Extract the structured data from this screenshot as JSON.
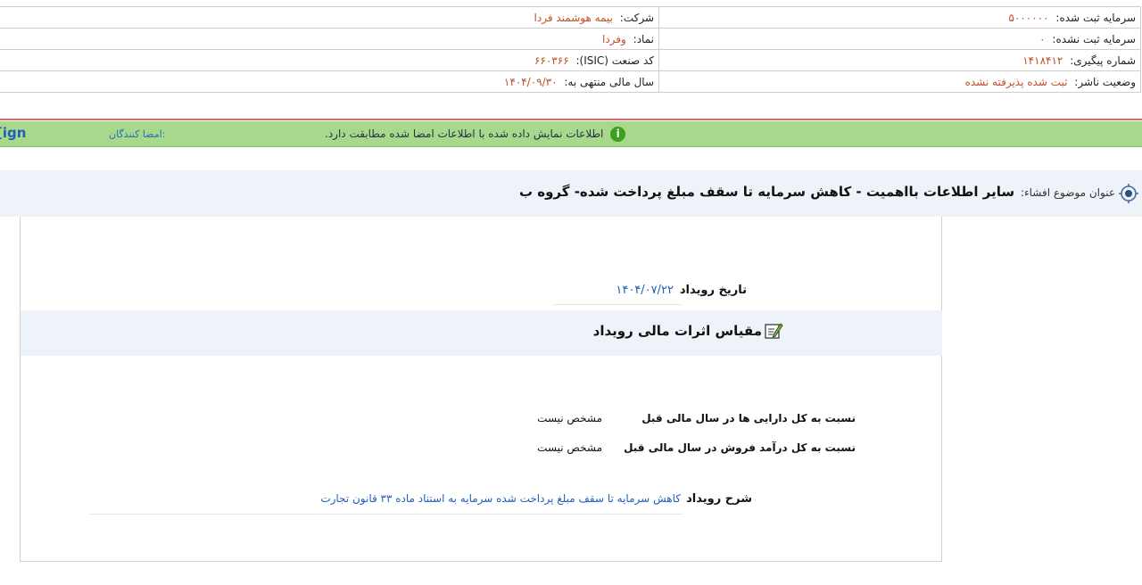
{
  "info": {
    "company_label": "شرکت:",
    "company_value": "بیمه هوشمند فردا",
    "registered_capital_label": "سرمایه ثبت شده:",
    "registered_capital_value": "۵۰۰۰۰۰۰",
    "symbol_label": "نماد:",
    "symbol_value": "وفردا",
    "unregistered_capital_label": "سرمایه ثبت نشده:",
    "unregistered_capital_value": "۰",
    "isic_label": "کد صنعت (ISIC):",
    "isic_value": "۶۶۰۳۶۶",
    "tracking_label": "شماره پیگیری:",
    "tracking_value": "۱۴۱۸۴۱۲",
    "fiscal_year_label": "سال مالی منتهی به:",
    "fiscal_year_value": "۱۴۰۴/۰۹/۳۰",
    "publisher_status_label": "وضعیت ناشر:",
    "publisher_status_value": "ثبت شده پذیرفته نشده"
  },
  "notice": {
    "message": "اطلاعات نمایش داده شده با اطلاعات امضا شده مطابقت دارد.",
    "signers_label": "امضا کنندگان:",
    "signers_link": "[ign"
  },
  "subject": {
    "prefix": "عنوان موضوع افشاء:",
    "title": "سایر اطلاعات بااهمیت - کاهش سرمایه تا سقف مبلغ پرداخت شده- گروه ب"
  },
  "event": {
    "date_label": "تاریخ رویداد",
    "date_value": "۱۴۰۴/۰۷/۲۲",
    "section_title": "مقیاس اثرات مالی رویداد",
    "ratio_assets_label": "نسبت به کل دارایی ها در سال مالی قبل",
    "ratio_assets_value": "مشخص نیست",
    "ratio_sales_label": "نسبت به کل درآمد فروش در سال مالی قبل",
    "ratio_sales_value": "مشخص نیست",
    "description_label": "شرح رویداد",
    "description_value": "کاهش سرمایه تا سقف مبلغ پرداخت شده سرمایه به استناد ماده ۳۳ قانون تجارت"
  },
  "colors": {
    "value_orange": "#c0502a",
    "link_blue": "#1f5fb8",
    "notice_green": "#a8d88c",
    "header_band": "#edf3f8",
    "red_rule": "#e06a6a"
  },
  "icons": {
    "notice": "info-icon",
    "subject": "target-icon",
    "section": "edit-note-icon"
  }
}
